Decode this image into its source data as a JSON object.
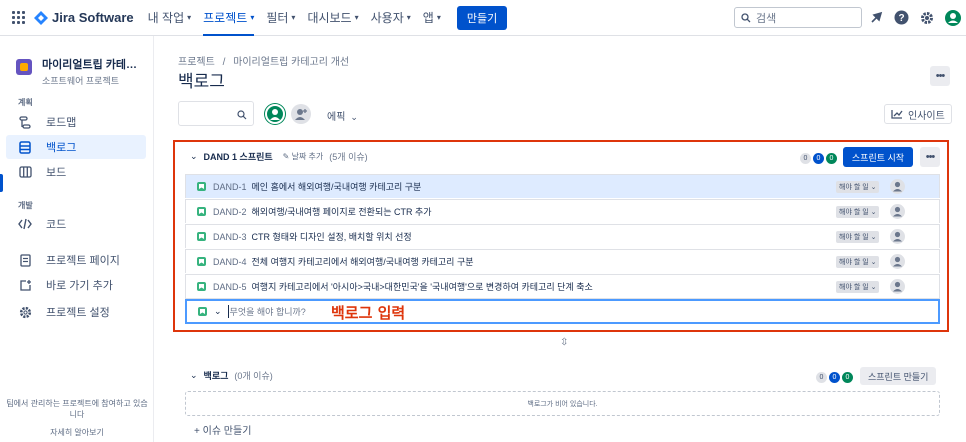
{
  "topbar": {
    "logo": "Jira Software",
    "nav": [
      {
        "label": "내 작업",
        "active": false
      },
      {
        "label": "프로젝트",
        "active": true
      },
      {
        "label": "필터",
        "active": false
      },
      {
        "label": "대시보드",
        "active": false
      },
      {
        "label": "사용자",
        "active": false
      },
      {
        "label": "앱",
        "active": false
      }
    ],
    "create": "만들기",
    "search_placeholder": "검색",
    "icons": [
      "notification-icon",
      "help-icon",
      "settings-icon",
      "profile-icon"
    ]
  },
  "sidebar": {
    "project_name": "마이리얼트립 카테고리...",
    "project_type": "소프트웨어 프로젝트",
    "section_planning": "계획",
    "section_dev": "개발",
    "items": [
      {
        "label": "로드맵",
        "icon": "roadmap-icon"
      },
      {
        "label": "백로그",
        "icon": "backlog-icon",
        "active": true
      },
      {
        "label": "보드",
        "icon": "board-icon"
      },
      {
        "label": "코드",
        "icon": "code-icon"
      },
      {
        "label": "프로젝트 페이지",
        "icon": "page-icon"
      },
      {
        "label": "바로 가기 추가",
        "icon": "add-shortcut-icon"
      },
      {
        "label": "프로젝트 설정",
        "icon": "gear-icon"
      }
    ],
    "footer": "팀에서 관리하는 프로젝트에 참여하고 있습니다",
    "learn_more": "자세히 알아보기"
  },
  "main": {
    "breadcrumb": {
      "root": "프로젝트",
      "sep": "/",
      "project": "마이리얼트립 카테고리 개선"
    },
    "title": "백로그",
    "epic_filter": "에픽",
    "insight": "인사이트",
    "sprint": {
      "name": "DAND 1 스프린트",
      "date_add": "날짜 추가",
      "count": "(5개 이슈)",
      "pills": [
        "0",
        "0",
        "0"
      ],
      "start": "스프린트 시작",
      "issues": [
        {
          "key": "DAND-1",
          "summary": "메인 홈에서 해외여행/국내여행 카테고리 구분",
          "status": "해야 할 일",
          "selected": true
        },
        {
          "key": "DAND-2",
          "summary": "해외여행/국내여행 페이지로 전환되는 CTR 추가",
          "status": "해야 할 일"
        },
        {
          "key": "DAND-3",
          "summary": "CTR 형태와 디자인 설정, 배치할 위치 선정",
          "status": "해야 할 일"
        },
        {
          "key": "DAND-4",
          "summary": "전체 여행지 카테고리에서 해외여행/국내여행 카테고리 구분",
          "status": "해야 할 일"
        },
        {
          "key": "DAND-5",
          "summary": "여행지 카테고리에서 '아시아>국내>대한민국'을 '국내여행'으로 변경하여 카테고리 단계 축소",
          "status": "해야 할 일"
        }
      ],
      "input_placeholder": "무엇을 해야 합니까?"
    },
    "annotation": "백로그 입력",
    "backlog": {
      "name": "백로그",
      "count": "(0개 이슈)",
      "pills": [
        "0",
        "0",
        "0"
      ],
      "make_sprint": "스프린트 만들기",
      "empty": "백로그가 비어 있습니다.",
      "create_issue": "+ 이슈 만들기"
    }
  },
  "colors": {
    "brand": "#0052cc",
    "annotation": "#de350b",
    "story": "#36b37e"
  }
}
